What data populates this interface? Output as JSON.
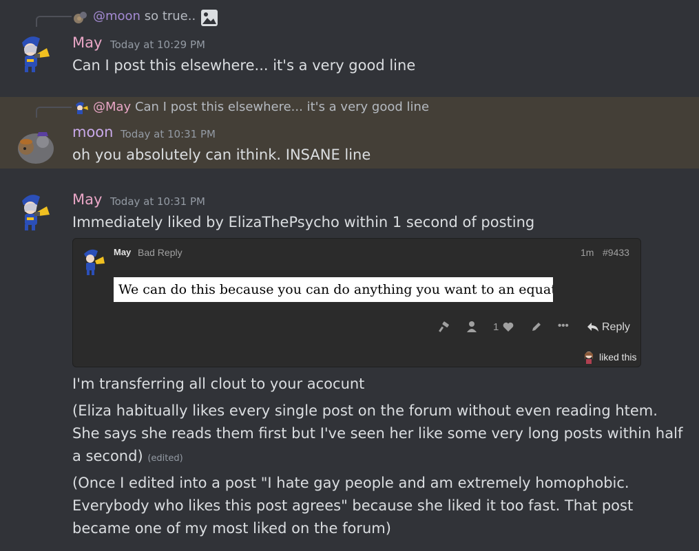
{
  "colors": {
    "background": "#313338",
    "highlight": "#443f37",
    "may_name": "#e9a6c6",
    "moon_name": "#c9a9e9",
    "embed_bg": "#2b2b2b"
  },
  "messages": [
    {
      "reply": {
        "mention": "@moon",
        "text": "so true..",
        "attachment_icon": "image-icon"
      },
      "author": "May",
      "timestamp": "Today at 10:29 PM",
      "content": "Can I post this elsewhere... it's a very good line"
    },
    {
      "reply": {
        "mention": "@May",
        "text": "Can I post this elsewhere... it's a very good line"
      },
      "author": "moon",
      "timestamp": "Today at 10:31 PM",
      "content": "oh you absolutely can ithink. INSANE line"
    },
    {
      "author": "May",
      "timestamp": "Today at 10:31 PM",
      "content": "Immediately liked by ElizaThePsycho within 1 second of posting",
      "embed": {
        "user": "May",
        "title": "Bad Reply",
        "age": "1m",
        "post_number": "#9433",
        "quote": "We can do this because you can do anything you want to an equation,",
        "like_count": "1",
        "reply_label": "Reply",
        "liked_label": "liked this",
        "icons": [
          "hammer-icon",
          "user-icon",
          "heart-icon",
          "pencil-icon",
          "more-icon",
          "reply-icon"
        ]
      },
      "followups": [
        {
          "text": "I'm transferring all clout to your acocunt"
        },
        {
          "text": "(Eliza habitually likes every single post on the forum without even reading htem. She says she reads them first but I've seen her like some very long posts within half a second)",
          "edited": "(edited)"
        },
        {
          "text": "(Once I edited into a post \"I hate gay people and am extremely homophobic. Everybody who likes this post agrees\" because she liked it too fast. That post became one of my most liked on the forum)"
        }
      ]
    }
  ]
}
